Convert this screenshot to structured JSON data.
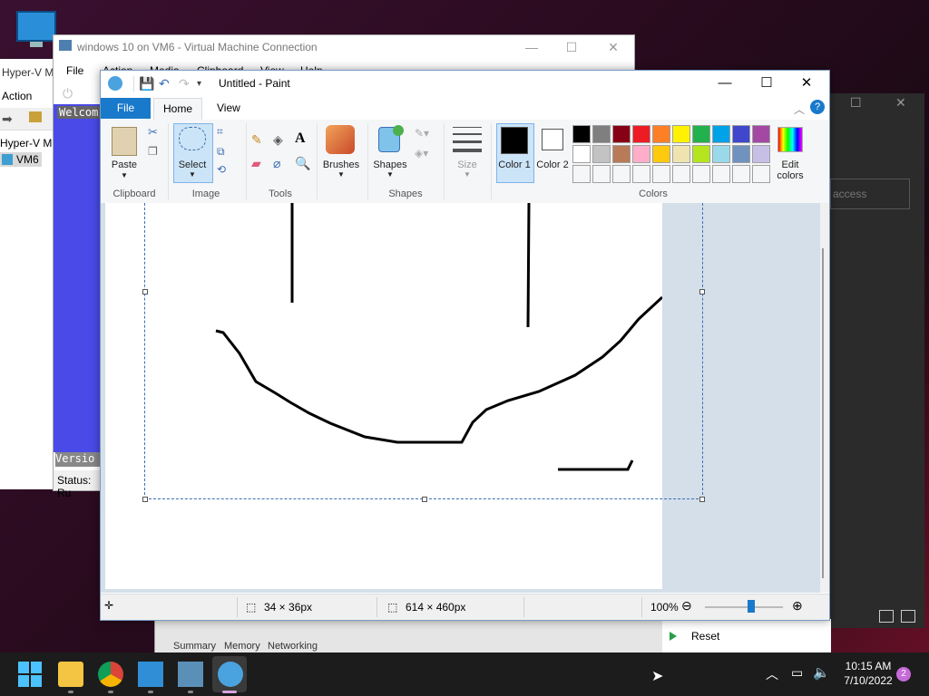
{
  "desktop": {
    "icon_label": "My Computer"
  },
  "hyperv": {
    "title": "Hyper-V M",
    "menu_action": "Action",
    "tree_root": "Hyper-V M",
    "tree_vm": "VM6"
  },
  "vmconnection": {
    "title": "windows 10 on VM6 - Virtual Machine Connection",
    "menu": [
      "File",
      "Action",
      "Media",
      "Clipboard",
      "View",
      "Help"
    ],
    "screen_welcome": "Welcom",
    "screen_version": "Versio",
    "status": "Status: Ru",
    "tabs": [
      "Summary",
      "Memory",
      "Networking"
    ],
    "reset_label": "Reset"
  },
  "dark_window": {
    "field_placeholder": "access"
  },
  "paint": {
    "title": "Untitled - Paint",
    "tabs": {
      "file": "File",
      "home": "Home",
      "view": "View"
    },
    "ribbon": {
      "paste": "Paste",
      "select": "Select",
      "brushes": "Brushes",
      "shapes": "Shapes",
      "size": "Size",
      "color1": "Color 1",
      "color2": "Color 2",
      "edit_colors": "Edit colors"
    },
    "groups": [
      "Clipboard",
      "Image",
      "Tools",
      "Shapes",
      "Colors"
    ],
    "palette_row1": [
      "#000000",
      "#7f7f7f",
      "#880015",
      "#ed1c24",
      "#ff7f27",
      "#fff200",
      "#22b14c",
      "#00a2e8",
      "#3f48cc",
      "#a349a4"
    ],
    "palette_row2": [
      "#ffffff",
      "#c3c3c3",
      "#b97a57",
      "#ffaec9",
      "#ffc90e",
      "#efe4b0",
      "#b5e61d",
      "#99d9ea",
      "#7092be",
      "#c8bfe7"
    ],
    "color1_value": "#000000",
    "color2_value": "#ffffff",
    "status": {
      "selection_size": "34 × 36px",
      "canvas_size": "614 × 460px",
      "zoom": "100%",
      "zoom_level": 1.0
    }
  },
  "taskbar": {
    "time": "10:15 AM",
    "date": "7/10/2022",
    "notifications": "2"
  }
}
